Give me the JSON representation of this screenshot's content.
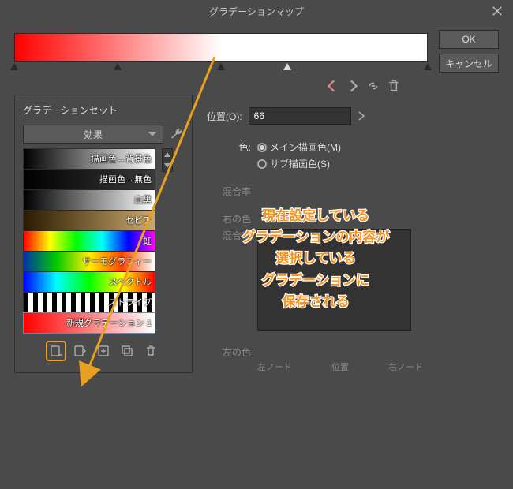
{
  "titlebar": {
    "title": "グラデーションマップ"
  },
  "buttons": {
    "ok": "OK",
    "cancel": "キャンセル"
  },
  "gradient_bar": {
    "stops": [
      0,
      25,
      50,
      66,
      100
    ]
  },
  "nav": {
    "prev": "prev",
    "next": "next",
    "lock": "lock",
    "delete": "delete"
  },
  "position": {
    "label": "位置(O):",
    "value": "66"
  },
  "color": {
    "label": "色:",
    "opt1": "メイン描画色(M)",
    "opt2": "サブ描画色(S)"
  },
  "mix": {
    "label": "混合率"
  },
  "right_color": {
    "label": "右の色"
  },
  "mix2": {
    "label": "混合率"
  },
  "left_color": {
    "label": "左の色"
  },
  "node_labels": {
    "left": "左ノード",
    "pos": "位置",
    "right": "右ノード"
  },
  "gradset": {
    "title": "グラデーションセット",
    "preset_selected": "効果",
    "items": [
      {
        "label": "描画色→背景色",
        "grad": "linear-gradient(to right,#000,#fff)"
      },
      {
        "label": "描画色→無色",
        "grad": "linear-gradient(to right,#000,transparent)"
      },
      {
        "label": "白黒",
        "grad": "linear-gradient(to right,#000,#fff)"
      },
      {
        "label": "セピア",
        "grad": "linear-gradient(to right,#2a1a00,#caa96e)"
      },
      {
        "label": "虹",
        "grad": "linear-gradient(to right,#f00,#ff0,#0f0,#0ff,#00f,#f0f)"
      },
      {
        "label": "サーモグラフィー",
        "grad": "linear-gradient(to right,#0033aa,#00cc00,#ffee00,#ff4400,#ffffff)"
      },
      {
        "label": "スペクトル",
        "grad": "linear-gradient(to right,#00f,#0ff,#0f0,#ff0,#f00)"
      },
      {
        "label": "ストライプ",
        "grad": "repeating-linear-gradient(to right,#000 0 6px,#fff 6px 12px)"
      },
      {
        "label": "新規グラデーション 1",
        "grad": "linear-gradient(to right,#f00,#fff)",
        "selected": true
      }
    ]
  },
  "annotation": {
    "text": "現在設定している\nグラデーションの内容が\n選択している\nグラデーションに\n保存される"
  }
}
